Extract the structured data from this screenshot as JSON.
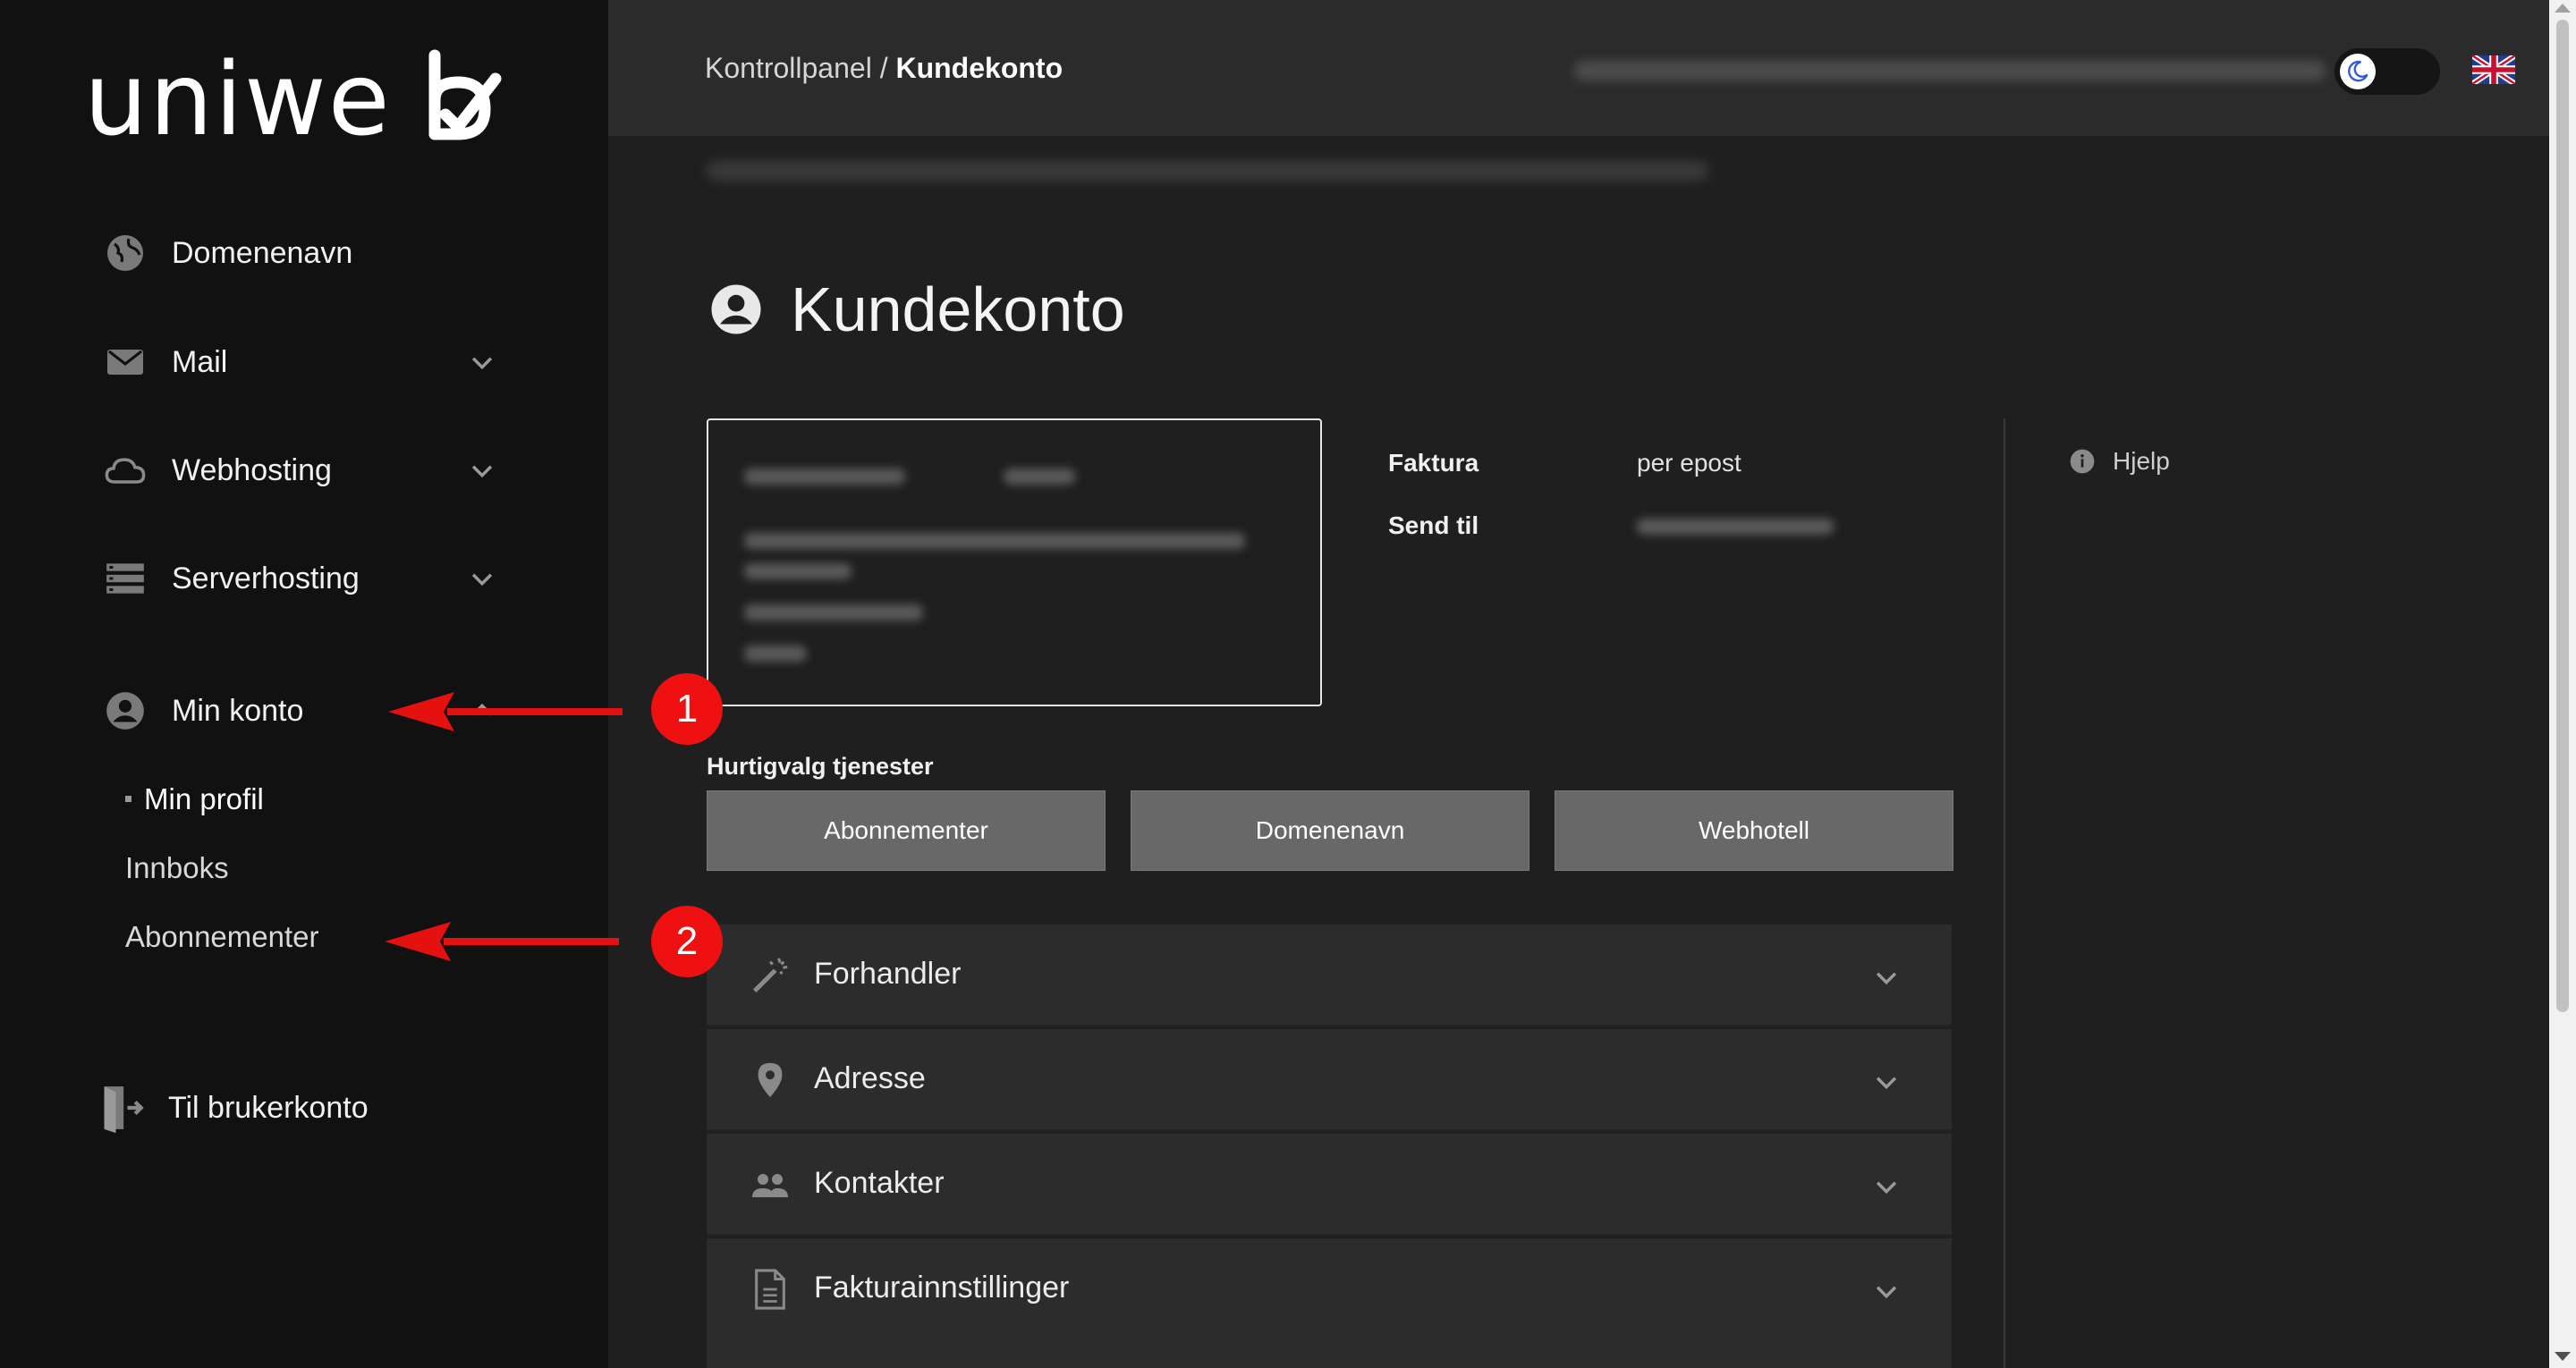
{
  "brand": {
    "logo_text": "uniweb"
  },
  "sidebar": {
    "items": [
      {
        "label": "Domenenavn",
        "icon": "globe-icon",
        "expandable": false
      },
      {
        "label": "Mail",
        "icon": "envelope-icon",
        "expandable": true
      },
      {
        "label": "Webhosting",
        "icon": "cloud-icon",
        "expandable": true
      },
      {
        "label": "Serverhosting",
        "icon": "server-icon",
        "expandable": true
      },
      {
        "label": "Min konto",
        "icon": "account-circle-icon",
        "expandable": true,
        "expanded": true
      }
    ],
    "sub_items": [
      {
        "label": "Min profil",
        "active": true
      },
      {
        "label": "Innboks",
        "active": false
      },
      {
        "label": "Abonnementer",
        "active": false
      }
    ],
    "exit_item": {
      "label": "Til brukerkonto",
      "icon": "exit-door-icon"
    }
  },
  "topbar": {
    "breadcrumb": {
      "root": "Kontrollpanel",
      "separator": "/",
      "current": "Kundekonto"
    },
    "theme_toggle_icon": "moon-icon",
    "language_flag": "uk-flag-icon"
  },
  "main": {
    "title": "Kundekonto",
    "title_icon": "account-circle-icon",
    "invoice": {
      "faktura_label": "Faktura",
      "faktura_value": "per epost",
      "send_til_label": "Send til"
    },
    "help_label": "Hjelp",
    "quick_title": "Hurtigvalg tjenester",
    "quick_buttons": [
      "Abonnementer",
      "Domenenavn",
      "Webhotell"
    ],
    "accordion": [
      {
        "label": "Forhandler",
        "icon": "magic-wand-icon"
      },
      {
        "label": "Adresse",
        "icon": "map-pin-icon"
      },
      {
        "label": "Kontakter",
        "icon": "people-icon"
      },
      {
        "label": "Fakturainnstillinger",
        "icon": "document-icon"
      }
    ]
  },
  "annotations": [
    {
      "number": "1",
      "points_to": "Min konto"
    },
    {
      "number": "2",
      "points_to": "Abonnementer"
    }
  ],
  "colors": {
    "sidebar_bg": "#111111",
    "main_bg": "#1f1f1f",
    "topbar_bg": "#2b2b2b",
    "button_bg": "#686868",
    "annotation_red": "#ef1111"
  }
}
